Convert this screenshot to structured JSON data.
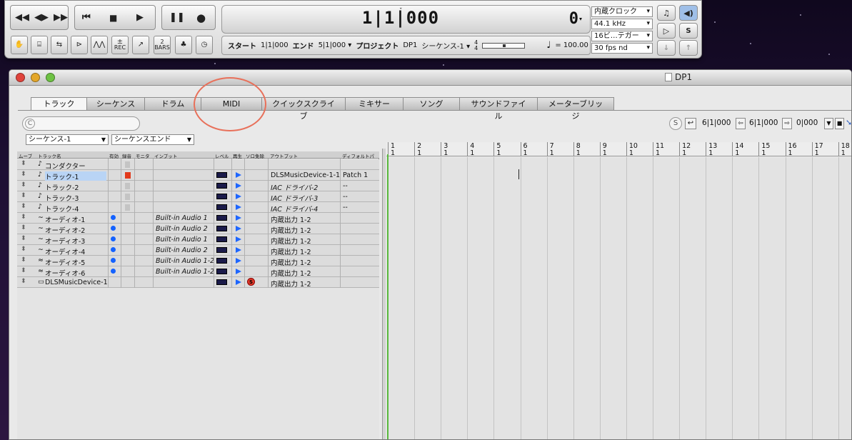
{
  "transport": {
    "icons": [
      "rewind-fast-icon",
      "shuttle-icon",
      "forward-fast-icon",
      "skip-to-start-icon",
      "stop-icon",
      "play-icon",
      "pause-icon",
      "record-icon"
    ],
    "tool_labels": [
      "",
      "",
      "",
      "",
      "",
      "REC",
      "",
      "2 BARS",
      "",
      ""
    ],
    "counter_time": "1|1|000",
    "counter_value": "0",
    "start_label": "スタート",
    "start_value": "1|1|000",
    "end_label": "エンド",
    "end_value": "5|1|000",
    "project_label": "プロジェクト",
    "project_value": "DP1",
    "sequence_value": "シーケンス-1",
    "time_sig_top": "4",
    "time_sig_bottom": "4",
    "tempo_value": "= 100.00",
    "clock_source": "内蔵クロック",
    "sample_rate": "44.1 kHz",
    "bit_depth": "16ビ…テガー",
    "frame_rate": "30 fps nd",
    "solo_label": "S"
  },
  "window": {
    "title": "DP1",
    "tabs": [
      "トラック",
      "シーケンス",
      "ドラム",
      "MIDI",
      "クイックスクライブ",
      "ミキサー",
      "ソング",
      "サウンドファイル",
      "メーターブリッジ"
    ],
    "active_tab": "トラック",
    "search_icon_label": "C",
    "sequence_select": "シーケンス-1",
    "sequence_end_select": "シーケンスエンド",
    "s_label": "S",
    "loop_start": "6|1|000",
    "loop_end": "6|1|000",
    "offset": "0|000"
  },
  "track_columns": {
    "move": "ムーブ",
    "name": "トラック名",
    "enable": "有効",
    "record": "録音",
    "monitor": "モニタ",
    "input": "インプット",
    "level": "レベル",
    "play": "再生",
    "solo_exempt": "ソロ免除",
    "output": "アウトプット",
    "default_patch": "ディフォルトパ"
  },
  "tracks": [
    {
      "icon": "conductor-icon",
      "name": "コンダクター",
      "enabled": false,
      "record": "gray",
      "input": "",
      "level": false,
      "play": false,
      "solo": false,
      "output": "",
      "patch": "",
      "italic": false
    },
    {
      "icon": "midi-note-icon",
      "name": "トラック-1",
      "enabled": false,
      "record": "red",
      "input": "",
      "level": true,
      "play": true,
      "solo": false,
      "output": "DLSMusicDevice-1-1",
      "patch": "Patch 1",
      "italic": false,
      "selected": true
    },
    {
      "icon": "midi-note-icon",
      "name": "トラック-2",
      "enabled": false,
      "record": "gray",
      "input": "",
      "level": true,
      "play": true,
      "solo": false,
      "output": "IAC ドライバ-2",
      "patch": "--",
      "italic": true
    },
    {
      "icon": "midi-note-icon",
      "name": "トラック-3",
      "enabled": false,
      "record": "gray",
      "input": "",
      "level": true,
      "play": true,
      "solo": false,
      "output": "IAC ドライバ-3",
      "patch": "--",
      "italic": true
    },
    {
      "icon": "midi-note-icon",
      "name": "トラック-4",
      "enabled": false,
      "record": "gray",
      "input": "",
      "level": true,
      "play": true,
      "solo": false,
      "output": "IAC ドライバ-4",
      "patch": "--",
      "italic": true
    },
    {
      "icon": "audio-mono-icon",
      "name": "オーディオ-1",
      "enabled": true,
      "record": "none",
      "input": "Built-in Audio 1",
      "level": true,
      "play": true,
      "solo": false,
      "output": "内蔵出力 1-2",
      "patch": "",
      "italic": false
    },
    {
      "icon": "audio-mono-icon",
      "name": "オーディオ-2",
      "enabled": true,
      "record": "none",
      "input": "Built-in Audio 2",
      "level": true,
      "play": true,
      "solo": false,
      "output": "内蔵出力 1-2",
      "patch": "",
      "italic": false
    },
    {
      "icon": "audio-mono-icon",
      "name": "オーディオ-3",
      "enabled": true,
      "record": "none",
      "input": "Built-in Audio 1",
      "level": true,
      "play": true,
      "solo": false,
      "output": "内蔵出力 1-2",
      "patch": "",
      "italic": false
    },
    {
      "icon": "audio-mono-icon",
      "name": "オーディオ-4",
      "enabled": true,
      "record": "none",
      "input": "Built-in Audio 2",
      "level": true,
      "play": true,
      "solo": false,
      "output": "内蔵出力 1-2",
      "patch": "",
      "italic": false
    },
    {
      "icon": "audio-stereo-icon",
      "name": "オーディオ-5",
      "enabled": true,
      "record": "none",
      "input": "Built-in Audio 1-2",
      "level": true,
      "play": true,
      "solo": false,
      "output": "内蔵出力 1-2",
      "patch": "",
      "italic": false
    },
    {
      "icon": "audio-stereo-icon",
      "name": "オーディオ-6",
      "enabled": true,
      "record": "none",
      "input": "Built-in Audio 1-2",
      "level": true,
      "play": true,
      "solo": false,
      "output": "内蔵出力 1-2",
      "patch": "",
      "italic": false
    },
    {
      "icon": "instrument-icon",
      "name": "DLSMusicDevice-1",
      "enabled": false,
      "record": "none",
      "input": "",
      "level": true,
      "play": true,
      "solo": true,
      "output": "内蔵出力 1-2",
      "patch": "",
      "italic": false
    }
  ],
  "ruler": {
    "bars": [
      "1",
      "2",
      "3",
      "4",
      "5",
      "6",
      "7",
      "8",
      "9",
      "10",
      "11",
      "12",
      "13",
      "14",
      "15",
      "16",
      "17",
      "18"
    ],
    "beats": [
      "1",
      "1",
      "1",
      "1",
      "1",
      "1",
      "1",
      "1",
      "1",
      "1",
      "1",
      "1",
      "1",
      "1",
      "1",
      "1",
      "1",
      "1"
    ]
  },
  "colors": {
    "accent_blue": "#1e66ff",
    "record_red": "#e23a1c",
    "annotation": "#e8705a",
    "cursor_green": "#59b93d"
  }
}
